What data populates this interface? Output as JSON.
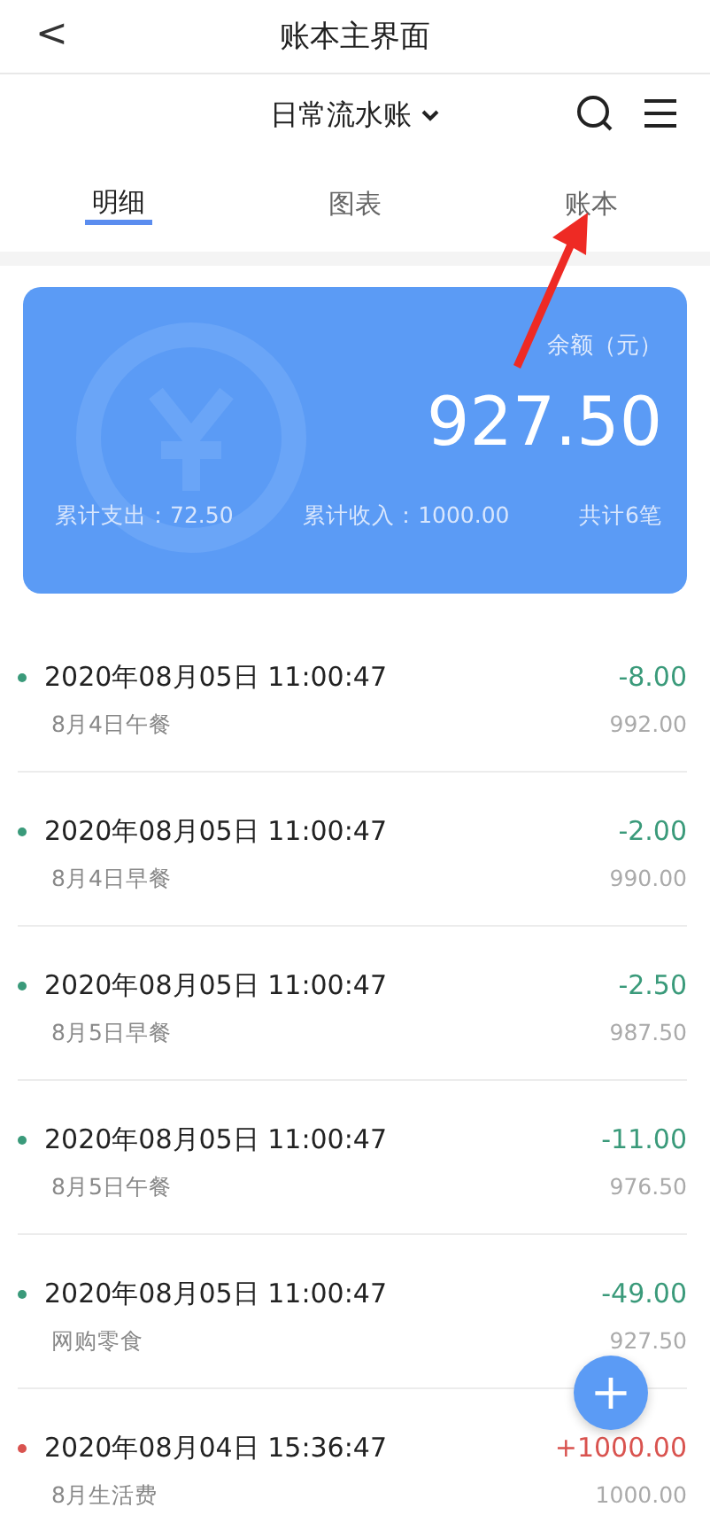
{
  "header": {
    "back": "<",
    "title": "账本主界面"
  },
  "book": {
    "name": "日常流水账"
  },
  "tabs": [
    {
      "label": "明细",
      "selected": true
    },
    {
      "label": "图表",
      "selected": false
    },
    {
      "label": "账本",
      "selected": false
    }
  ],
  "summary": {
    "balance_label": "余额（元）",
    "balance": "927.50",
    "expense": "累计支出：72.50",
    "income": "累计收入：1000.00",
    "count": "共计6笔"
  },
  "records": [
    {
      "time": "2020年08月05日 11:00:47",
      "note": "8月4日午餐",
      "amount": "-8.00",
      "remaining": "992.00",
      "color": "#3a9a7a"
    },
    {
      "time": "2020年08月05日 11:00:47",
      "note": "8月4日早餐",
      "amount": "-2.00",
      "remaining": "990.00",
      "color": "#3a9a7a"
    },
    {
      "time": "2020年08月05日 11:00:47",
      "note": "8月5日早餐",
      "amount": "-2.50",
      "remaining": "987.50",
      "color": "#3a9a7a"
    },
    {
      "time": "2020年08月05日 11:00:47",
      "note": "8月5日午餐",
      "amount": "-11.00",
      "remaining": "976.50",
      "color": "#3a9a7a"
    },
    {
      "time": "2020年08月05日 11:00:47",
      "note": "网购零食",
      "amount": "-49.00",
      "remaining": "927.50",
      "color": "#3a9a7a"
    },
    {
      "time": "2020年08月04日 15:36:47",
      "note": "8月生活费",
      "amount": "+1000.00",
      "remaining": "1000.00",
      "color": "#d9534f"
    }
  ],
  "fab": {
    "symbol": "+"
  }
}
